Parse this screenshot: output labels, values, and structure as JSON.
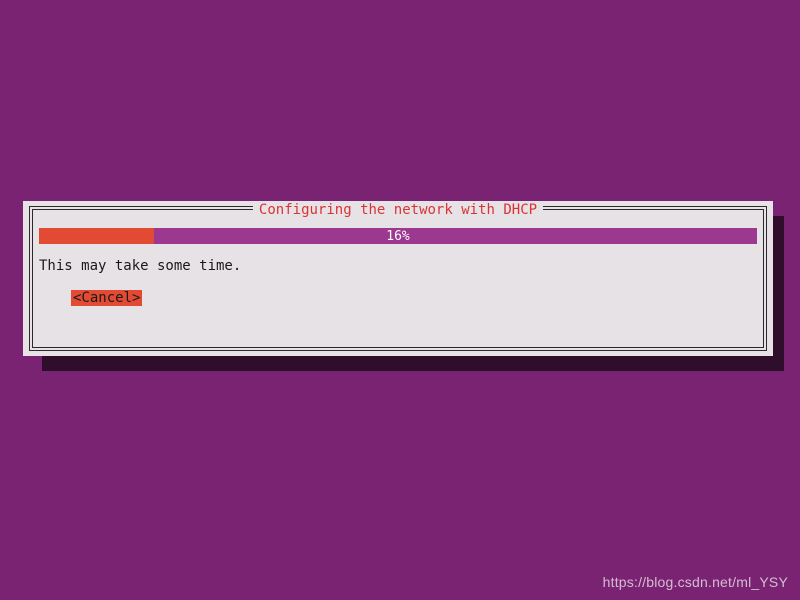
{
  "dialog": {
    "title": "Configuring the network with DHCP",
    "progress": {
      "percent": 16,
      "label": "16%"
    },
    "message": "This may take some time.",
    "cancel_label": "<Cancel>"
  },
  "watermark": "https://blog.csdn.net/ml_YSY",
  "colors": {
    "background": "#7a2373",
    "dialog_bg": "#e7e2e5",
    "progress_track": "#9c3890",
    "progress_fill": "#e24a33",
    "title_text": "#d93434",
    "shadow": "#2e0e2b"
  }
}
